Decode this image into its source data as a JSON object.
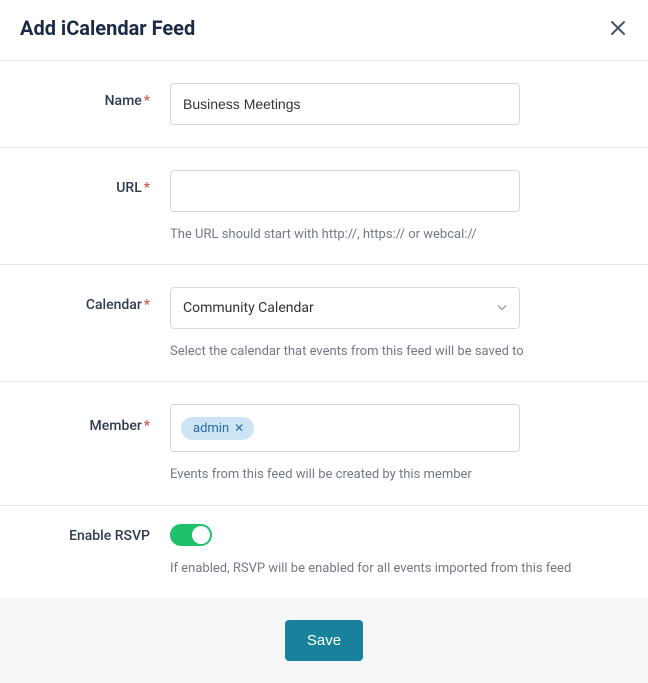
{
  "header": {
    "title": "Add iCalendar Feed"
  },
  "form": {
    "name": {
      "label": "Name",
      "value": "Business Meetings"
    },
    "url": {
      "label": "URL",
      "value": "",
      "help": "The URL should start with http://, https:// or webcal://"
    },
    "calendar": {
      "label": "Calendar",
      "selected": "Community Calendar",
      "help": "Select the calendar that events from this feed will be saved to"
    },
    "member": {
      "label": "Member",
      "tags": [
        {
          "label": "admin"
        }
      ],
      "help": "Events from this feed will be created by this member"
    },
    "rsvp": {
      "label": "Enable RSVP",
      "help": "If enabled, RSVP will be enabled for all events imported from this feed"
    }
  },
  "footer": {
    "save_label": "Save"
  }
}
